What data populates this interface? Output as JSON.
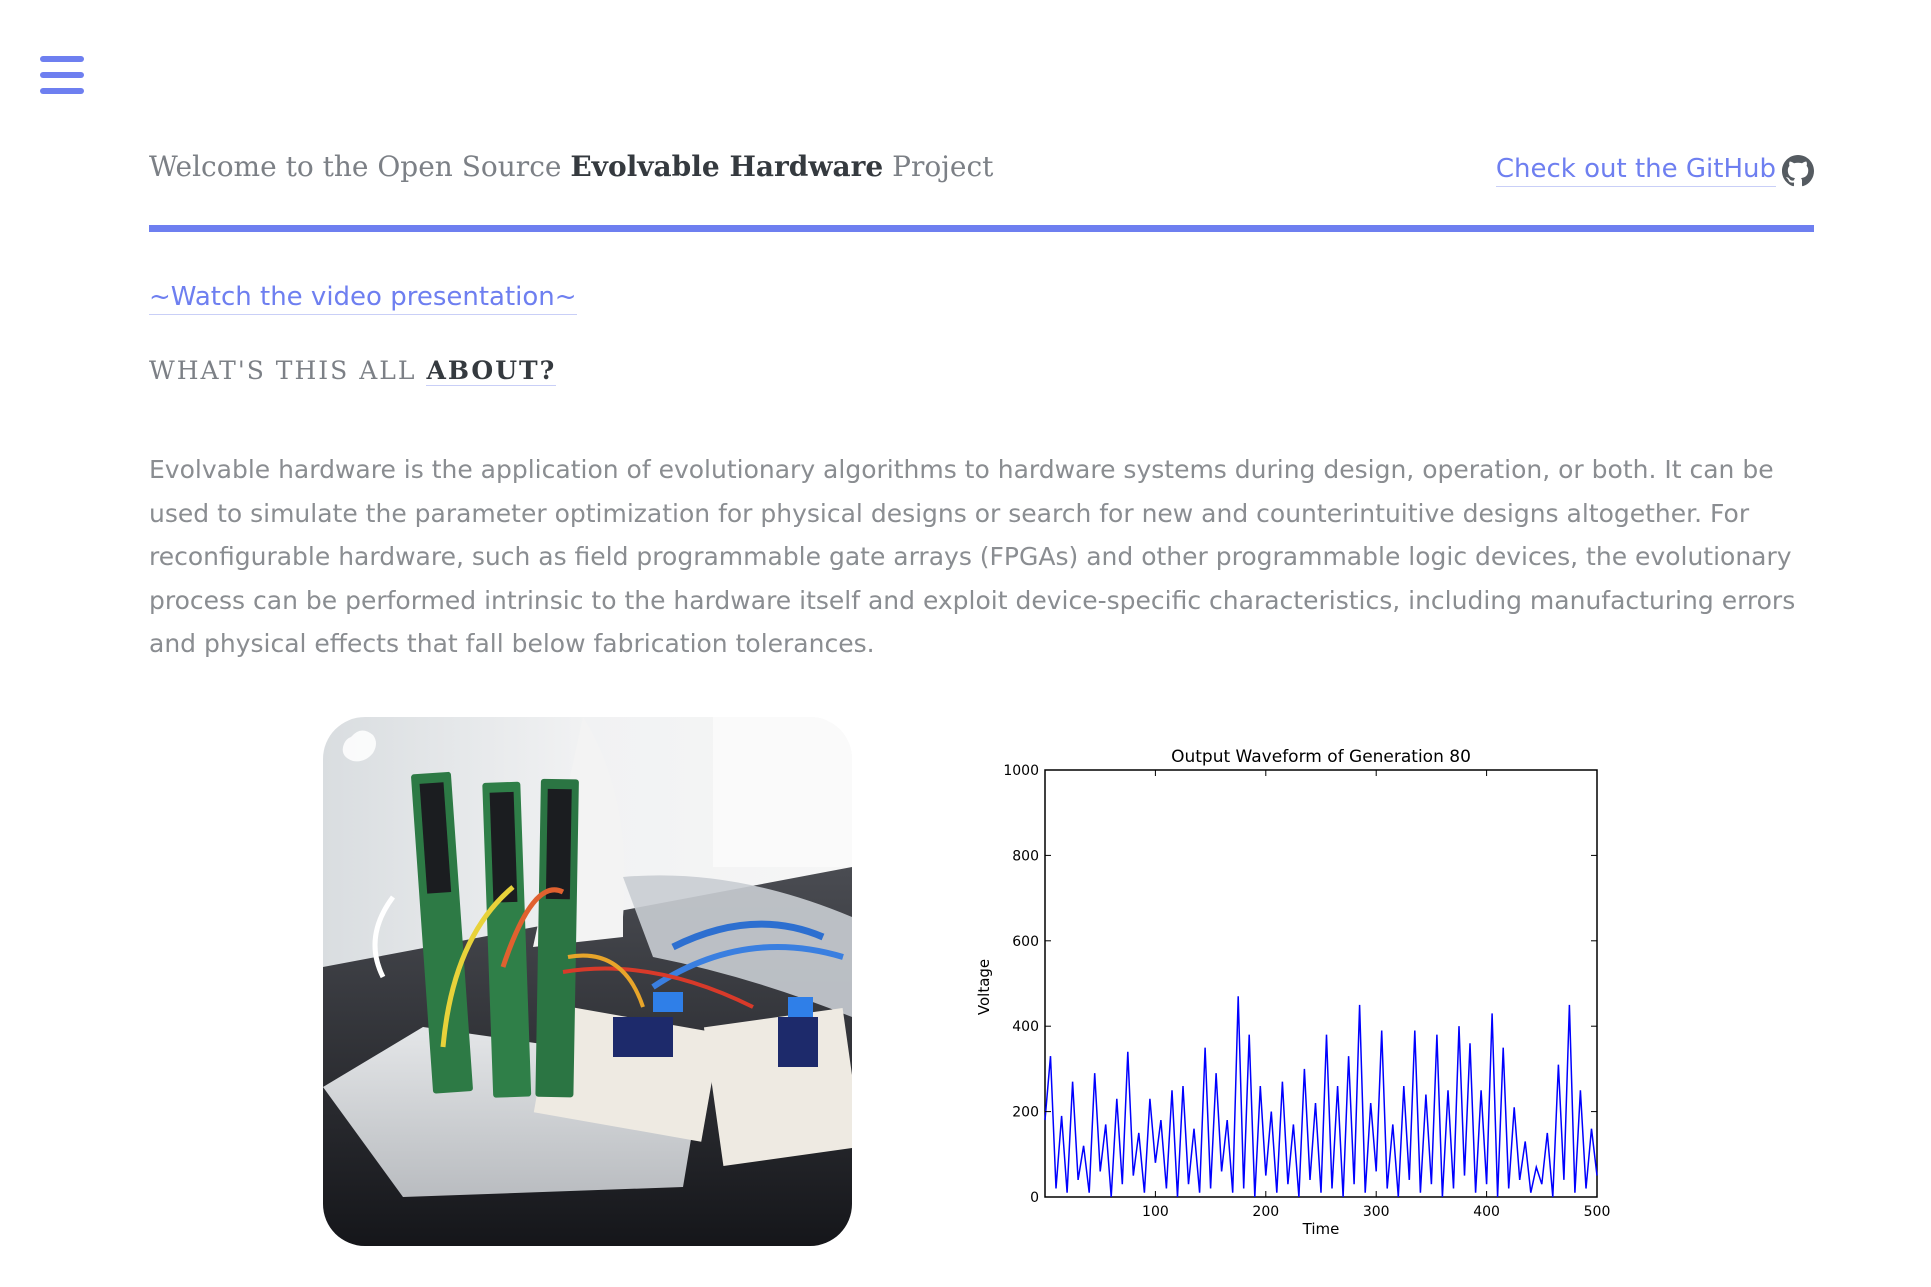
{
  "nav": {
    "menu_icon": "hamburger-menu-icon"
  },
  "header": {
    "title_prefix": "Welcome to the Open Source ",
    "title_bold": "Evolvable Hardware",
    "title_suffix": " Project",
    "github_link_text": "Check out the GitHub",
    "github_icon": "github-icon"
  },
  "colors": {
    "accent": "#6e7ff0",
    "heading_dark": "#353a3f",
    "body_text": "#8a8d91",
    "waveform": "#0000ff"
  },
  "video_link": "~Watch the video presentation~",
  "about": {
    "heading_prefix": "WHAT'S THIS ALL ",
    "heading_bold": "ABOUT?",
    "paragraph": "Evolvable hardware is the application of evolutionary algorithms to hardware systems during design, operation, or both. It can be used to simulate the parameter optimization for physical designs or search for new and counterintuitive designs altogether. For reconfigurable hardware, such as field programmable gate arrays (FPGAs) and other programmable logic devices, the evolutionary process can be performed intrinsic to the hardware itself and exploit device-specific characteristics, including manufacturing errors and physical effects that fall below fabrication tolerances."
  },
  "photo": {
    "subject": "evolvable-hardware-rig-photo"
  },
  "chart_data": {
    "type": "line",
    "title": "Output Waveform of Generation 80",
    "xlabel": "Time",
    "ylabel": "Voltage",
    "xlim": [
      0,
      500
    ],
    "ylim": [
      0,
      1000
    ],
    "xticks": [
      100,
      200,
      300,
      400,
      500
    ],
    "yticks": [
      0,
      200,
      400,
      600,
      800,
      1000
    ],
    "grid": false,
    "series": [
      {
        "color": "#0000ff",
        "x": [
          0,
          5,
          10,
          15,
          20,
          25,
          30,
          35,
          40,
          45,
          50,
          55,
          60,
          65,
          70,
          75,
          80,
          85,
          90,
          95,
          100,
          105,
          110,
          115,
          120,
          125,
          130,
          135,
          140,
          145,
          150,
          155,
          160,
          165,
          170,
          175,
          180,
          185,
          190,
          195,
          200,
          205,
          210,
          215,
          220,
          225,
          230,
          235,
          240,
          245,
          250,
          255,
          260,
          265,
          270,
          275,
          280,
          285,
          290,
          295,
          300,
          305,
          310,
          315,
          320,
          325,
          330,
          335,
          340,
          345,
          350,
          355,
          360,
          365,
          370,
          375,
          380,
          385,
          390,
          395,
          400,
          405,
          410,
          415,
          420,
          425,
          430,
          435,
          440,
          445,
          450,
          455,
          460,
          465,
          470,
          475,
          480,
          485,
          490,
          495,
          500
        ],
        "y": [
          180,
          330,
          20,
          190,
          10,
          270,
          40,
          120,
          10,
          290,
          60,
          170,
          0,
          230,
          30,
          340,
          50,
          150,
          10,
          230,
          80,
          180,
          20,
          250,
          0,
          260,
          30,
          160,
          10,
          350,
          20,
          290,
          60,
          180,
          10,
          470,
          20,
          380,
          0,
          260,
          50,
          200,
          10,
          270,
          30,
          170,
          0,
          300,
          40,
          220,
          10,
          380,
          20,
          260,
          0,
          330,
          30,
          450,
          10,
          220,
          60,
          390,
          20,
          170,
          0,
          260,
          40,
          390,
          10,
          240,
          30,
          380,
          0,
          250,
          20,
          400,
          50,
          360,
          10,
          250,
          30,
          430,
          0,
          350,
          20,
          210,
          40,
          130,
          10,
          70,
          30,
          150,
          0,
          310,
          40,
          450,
          10,
          250,
          20,
          160,
          50
        ]
      }
    ]
  }
}
